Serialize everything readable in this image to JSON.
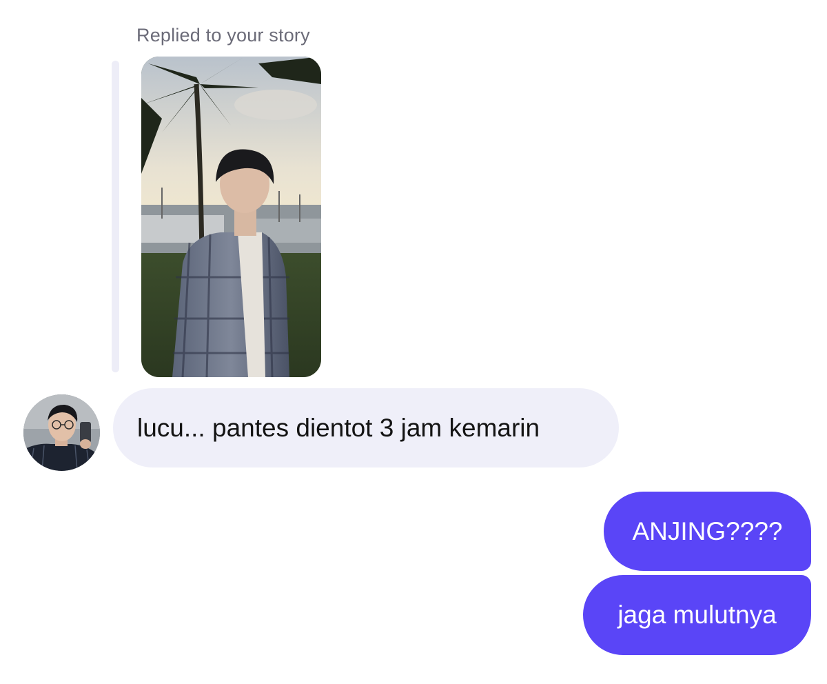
{
  "conversation": {
    "reply_context": {
      "label": "Replied to your story",
      "story_thumbnail": "story-photo-man-in-plaid-shirt-palm-trees-marina"
    },
    "messages": [
      {
        "direction": "incoming",
        "sender_avatar": "avatar-man-with-glasses-mirror-selfie",
        "text": "lucu... pantes dientot 3 jam kemarin"
      },
      {
        "direction": "outgoing",
        "text": "ANJING????"
      },
      {
        "direction": "outgoing",
        "text": "jaga mulutnya"
      }
    ]
  },
  "colors": {
    "background": "#ffffff",
    "incoming_bubble": "#efeff9",
    "outgoing_bubble": "#5a45f7",
    "reply_bar": "#ededf7",
    "reply_label": "#6b6b78"
  }
}
